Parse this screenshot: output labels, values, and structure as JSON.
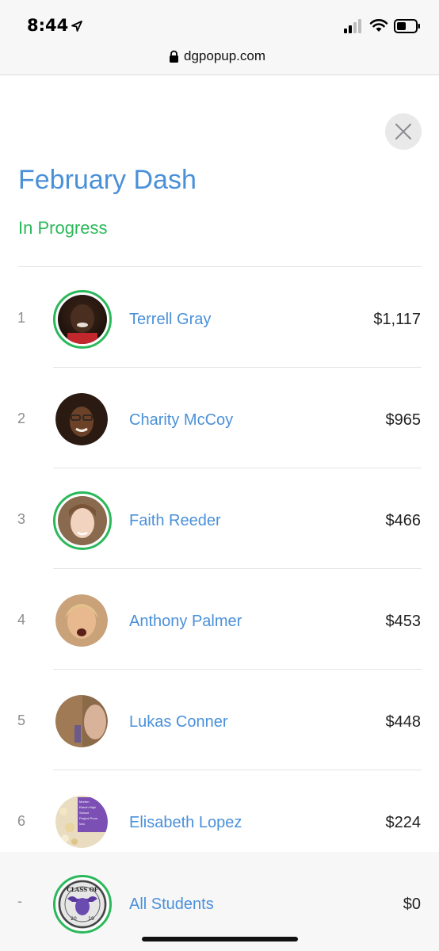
{
  "status_bar": {
    "time": "8:44"
  },
  "browser": {
    "url": "dgpopup.com"
  },
  "page": {
    "title": "February Dash",
    "status": "In Progress"
  },
  "leaderboard": [
    {
      "rank": "1",
      "name": "Terrell Gray",
      "amount": "$1,117",
      "ring": true
    },
    {
      "rank": "2",
      "name": "Charity McCoy",
      "amount": "$965",
      "ring": false
    },
    {
      "rank": "3",
      "name": "Faith Reeder",
      "amount": "$466",
      "ring": true
    },
    {
      "rank": "4",
      "name": "Anthony Palmer",
      "amount": "$453",
      "ring": false
    },
    {
      "rank": "5",
      "name": "Lukas Conner",
      "amount": "$448",
      "ring": false
    },
    {
      "rank": "6",
      "name": "Elisabeth Lopez",
      "amount": "$224",
      "ring": false
    }
  ],
  "total_row": {
    "rank": "-",
    "name": "All Students",
    "amount": "$0"
  },
  "avatar_badges": {
    "elisabeth_card_lines": [
      "Morton",
      "Ranch High",
      "School",
      "Project Prom",
      "Now"
    ],
    "class_badge_top": "CLASS OF",
    "class_badge_left": "20",
    "class_badge_right": "19"
  },
  "colors": {
    "accent_blue": "#4a90d9",
    "status_green": "#2bb85a",
    "row_highlight": "#f7f7f8"
  }
}
